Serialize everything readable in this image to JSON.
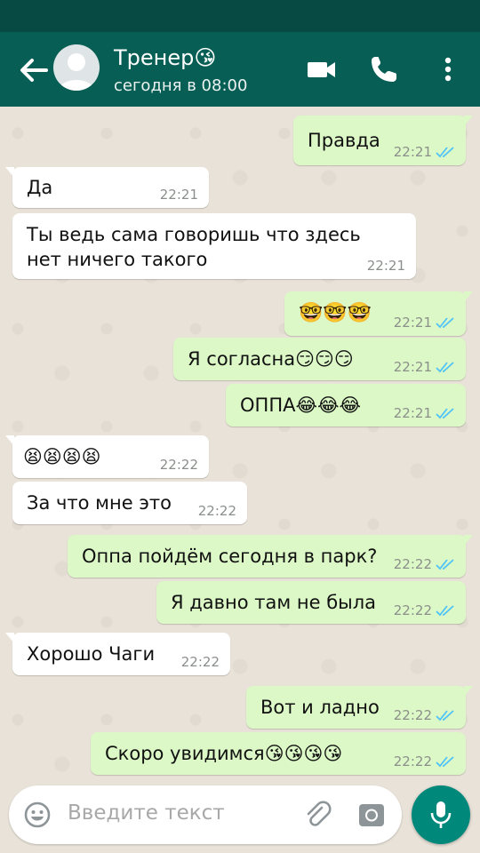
{
  "colors": {
    "header": "#075e54",
    "status_bar": "#064a43",
    "outgoing_bubble": "#dcf8c6",
    "incoming_bubble": "#ffffff",
    "read_ticks": "#4fc3f7",
    "fab": "#00897b"
  },
  "header": {
    "contact_name": "Тренер😘",
    "last_seen": "сегодня в 08:00",
    "icons": [
      "back-arrow-icon",
      "avatar",
      "video-call-icon",
      "phone-icon",
      "more-vert-icon"
    ]
  },
  "messages": [
    {
      "id": "m1",
      "dir": "out",
      "text": "Правда",
      "time": "22:21",
      "read": true
    },
    {
      "id": "m2",
      "dir": "in",
      "text": "Да",
      "time": "22:21"
    },
    {
      "id": "m3",
      "dir": "in",
      "text": "Ты ведь сама говоришь что здесь\nнет ничего такого",
      "time": "22:21"
    },
    {
      "id": "m4",
      "dir": "out",
      "text": "🤓🤓🤓",
      "time": "22:21",
      "read": true
    },
    {
      "id": "m5",
      "dir": "out",
      "text": "Я согласна😏😏😏",
      "time": "22:21",
      "read": true
    },
    {
      "id": "m6",
      "dir": "out",
      "text": "ОППА😂😂😂",
      "time": "22:21",
      "read": true
    },
    {
      "id": "m7",
      "dir": "in",
      "text": "😫😫😫😫",
      "time": "22:22"
    },
    {
      "id": "m8",
      "dir": "in",
      "text": "За что мне это",
      "time": "22:22"
    },
    {
      "id": "m9",
      "dir": "out",
      "text": "Оппа пойдём сегодня в парк?",
      "time": "22:22",
      "read": true
    },
    {
      "id": "m10",
      "dir": "out",
      "text": "Я давно там не была",
      "time": "22:22",
      "read": true
    },
    {
      "id": "m11",
      "dir": "in",
      "text": "Хорошо Чаги",
      "time": "22:22"
    },
    {
      "id": "m12",
      "dir": "out",
      "text": "Вот и ладно",
      "time": "22:22",
      "read": true
    },
    {
      "id": "m13",
      "dir": "out",
      "text": "Скоро увидимся😘😘😘😘",
      "time": "22:22",
      "read": true
    }
  ],
  "composer": {
    "placeholder": "Введите текст",
    "icons": [
      "emoji-icon",
      "attach-icon",
      "camera-icon",
      "mic-icon"
    ]
  }
}
